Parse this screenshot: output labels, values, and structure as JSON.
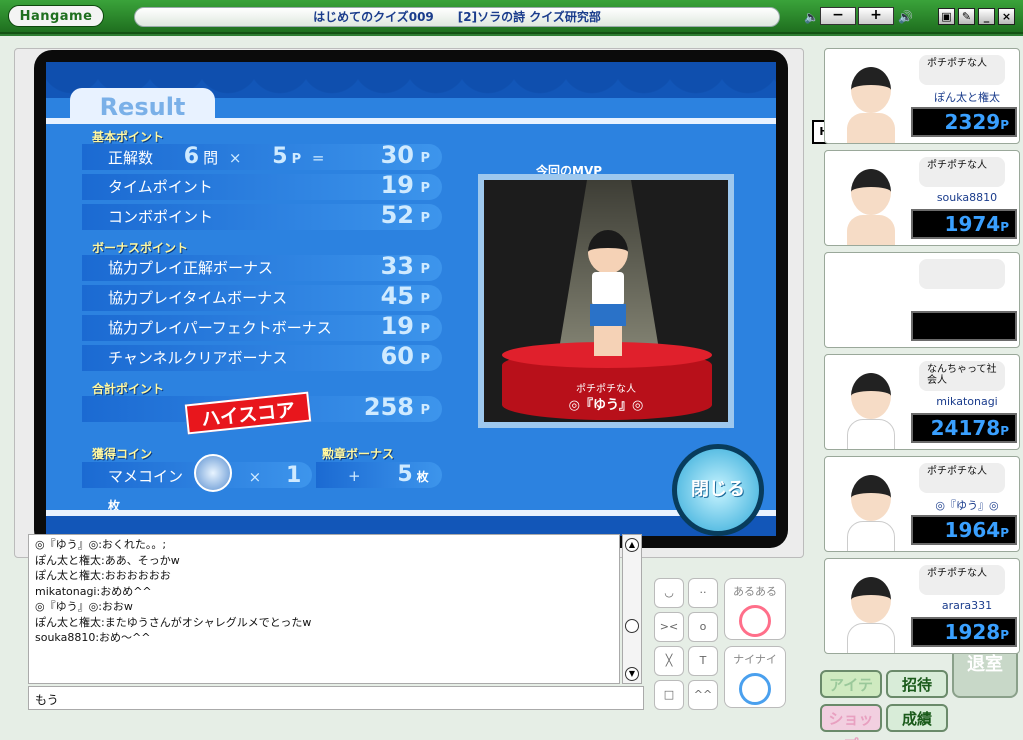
{
  "titlebar": {
    "logo": "Hangame",
    "title": "はじめてのクイズ009　　[2]ソラの詩 クイズ研究部",
    "vol_minus": "−",
    "vol_plus": "+",
    "win_buttons": [
      "▣",
      "✎",
      "_",
      "×"
    ]
  },
  "result": {
    "tab": "Result",
    "basic_label": "基本ポイント",
    "correct_label": "正解数",
    "correct_count": "6",
    "correct_unit": "問",
    "times": "×",
    "per_point": "5",
    "per_point_unit": "P",
    "equals": "=",
    "correct_total": "30",
    "time_label": "タイムポイント",
    "time_total": "19",
    "combo_label": "コンボポイント",
    "combo_total": "52",
    "bonus_label": "ボーナスポイント",
    "bonus_rows": [
      {
        "label": "協力プレイ正解ボーナス",
        "value": "33"
      },
      {
        "label": "協力プレイタイムボーナス",
        "value": "45"
      },
      {
        "label": "協力プレイパーフェクトボーナス",
        "value": "19"
      },
      {
        "label": "チャンネルクリアボーナス",
        "value": "60"
      }
    ],
    "p_unit": "P",
    "total_label": "合計ポイント",
    "hiscore": "ハイスコア",
    "total_value": "258",
    "coin_label": "獲得コイン",
    "coin_name": "マメコイン",
    "coin_times": "×",
    "coin_count": "1",
    "coin_unit": "枚",
    "medal_label": "勲章ボーナス",
    "medal_plus": "+",
    "medal_count": "5",
    "medal_unit": "枚",
    "mvp_title": "今回のMVP",
    "mvp_caption": "ポチポチな人",
    "mvp_name": "◎『ゆう』◎",
    "close": "閉じる"
  },
  "chat": {
    "lines": [
      "◎『ゆう』◎:おくれた。。;",
      "ぽん太と権太:ああ、そっかw",
      "ぽん太と権太:おおおおおお",
      "mikatonagi:おめめ^^",
      "◎『ゆう』◎:おおw",
      "ぽん太と権太:またゆうさんがオシャレグルメでとったw",
      "souka8810:おめ〜^^"
    ],
    "input_value": "もう"
  },
  "emotes": {
    "aruaru": "あるある",
    "nainai": "ナイナイ"
  },
  "actions": {
    "item": "アイテム",
    "invite": "招待",
    "shop": "ショップ",
    "record": "成績",
    "exit": "退室"
  },
  "players": [
    {
      "title": "ポチポチな人",
      "name": "ぽん太と権太",
      "score": "2329",
      "unit": "P",
      "host_mark": "H"
    },
    {
      "title": "ポチポチな人",
      "name": "souka8810",
      "score": "1974",
      "unit": "P"
    },
    {
      "title": "",
      "name": "",
      "score": "",
      "unit": ""
    },
    {
      "title": "なんちゃって社会人",
      "name": "mikatonagi",
      "score": "24178",
      "unit": "P"
    },
    {
      "title": "ポチポチな人",
      "name": "◎『ゆう』◎",
      "score": "1964",
      "unit": "P"
    },
    {
      "title": "ポチポチな人",
      "name": "arara331",
      "score": "1928",
      "unit": "P"
    }
  ]
}
